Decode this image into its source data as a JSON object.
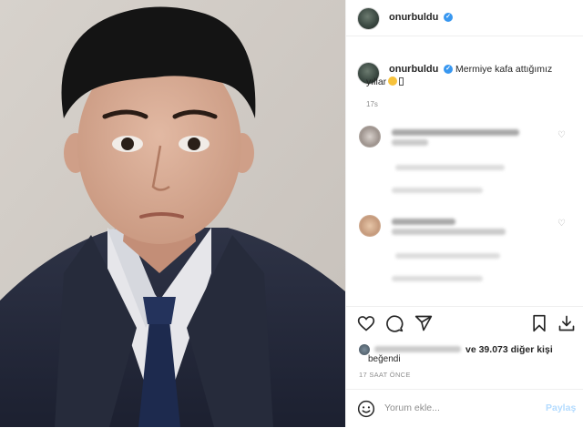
{
  "post": {
    "photo_alt": "",
    "author": {
      "username": "onurbuldu",
      "verified": true
    }
  },
  "caption": {
    "username": "onurbuldu",
    "text_line1": "Mermiye kafa attığımız",
    "text_line2": "yıllar",
    "time": "17s"
  },
  "actions": {
    "like_icon": "heart-icon",
    "comment_icon": "comment-icon",
    "share_icon": "send-icon",
    "save_icon": "bookmark-icon",
    "download_icon": "download-icon"
  },
  "likes": {
    "count_text": "ve 39.073 diğer kişi",
    "liked_label": "beğendi"
  },
  "time_ago": "17 SAAT ÖNCE",
  "comment_box": {
    "placeholder": "Yorum ekle...",
    "post_label": "Paylaş"
  },
  "colors": {
    "accent": "#3897f0",
    "post_disabled": "#b3dbff",
    "muted": "#8e8e8e"
  }
}
